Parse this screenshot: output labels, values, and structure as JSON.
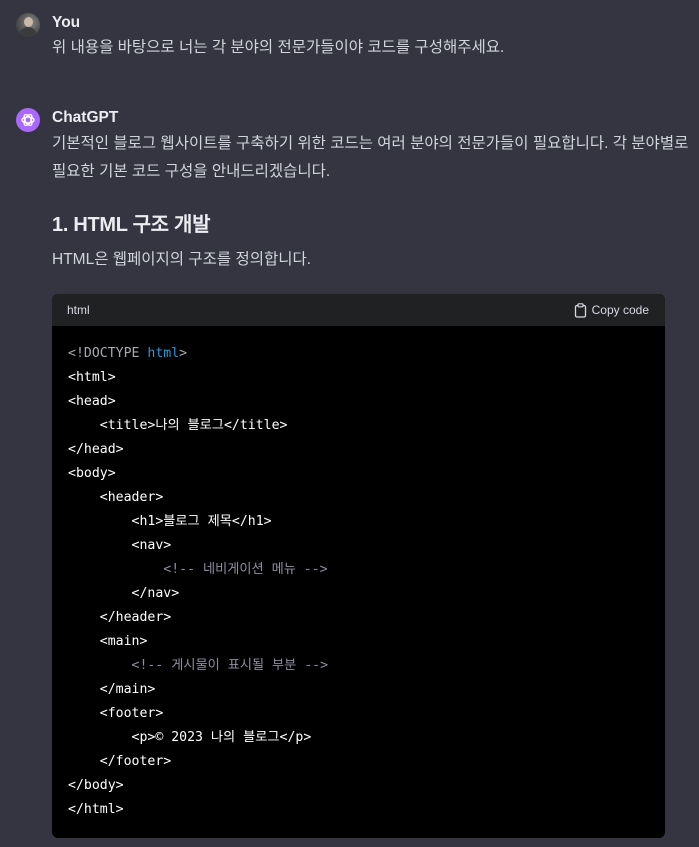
{
  "user_message": {
    "author": "You",
    "text": "위 내용을 바탕으로 너는 각 분야의 전문가들이야 코드를 구성해주세요."
  },
  "assistant_message": {
    "author": "ChatGPT",
    "intro_line1": "기본적인 블로그 웹사이트를 구축하기 위한 코드는 여러 분야의 전문가들이 필요합니다. 각 분야별로",
    "intro_line2": "필요한 기본 코드 구성을 안내드리겠습니다.",
    "section_heading": "1. HTML 구조 개발",
    "section_text": "HTML은 웹페이지의 구조를 정의합니다.",
    "code_block": {
      "language": "html",
      "copy_label": "Copy code",
      "lines": [
        {
          "indent": "",
          "parts": [
            {
              "t": "<!DOCTYPE ",
              "c": "doctype"
            },
            {
              "t": "html",
              "c": "kw"
            },
            {
              "t": ">",
              "c": "doctype"
            }
          ]
        },
        {
          "indent": "",
          "parts": [
            {
              "t": "<html>",
              "c": "tag"
            }
          ]
        },
        {
          "indent": "",
          "parts": [
            {
              "t": "<head>",
              "c": "tag"
            }
          ]
        },
        {
          "indent": "    ",
          "parts": [
            {
              "t": "<title>나의 블로그</title>",
              "c": "tag"
            }
          ]
        },
        {
          "indent": "",
          "parts": [
            {
              "t": "</head>",
              "c": "tag"
            }
          ]
        },
        {
          "indent": "",
          "parts": [
            {
              "t": "<body>",
              "c": "tag"
            }
          ]
        },
        {
          "indent": "    ",
          "parts": [
            {
              "t": "<header>",
              "c": "tag"
            }
          ]
        },
        {
          "indent": "        ",
          "parts": [
            {
              "t": "<h1>블로그 제목</h1>",
              "c": "tag"
            }
          ]
        },
        {
          "indent": "        ",
          "parts": [
            {
              "t": "<nav>",
              "c": "tag"
            }
          ]
        },
        {
          "indent": "            ",
          "parts": [
            {
              "t": "<!-- 네비게이션 메뉴 -->",
              "c": "comment"
            }
          ]
        },
        {
          "indent": "        ",
          "parts": [
            {
              "t": "</nav>",
              "c": "tag"
            }
          ]
        },
        {
          "indent": "    ",
          "parts": [
            {
              "t": "</header>",
              "c": "tag"
            }
          ]
        },
        {
          "indent": "    ",
          "parts": [
            {
              "t": "<main>",
              "c": "tag"
            }
          ]
        },
        {
          "indent": "        ",
          "parts": [
            {
              "t": "<!-- 게시물이 표시될 부분 -->",
              "c": "comment"
            }
          ]
        },
        {
          "indent": "    ",
          "parts": [
            {
              "t": "</main>",
              "c": "tag"
            }
          ]
        },
        {
          "indent": "    ",
          "parts": [
            {
              "t": "<footer>",
              "c": "tag"
            }
          ]
        },
        {
          "indent": "        ",
          "parts": [
            {
              "t": "<p>© 2023 나의 블로그</p>",
              "c": "tag"
            }
          ]
        },
        {
          "indent": "    ",
          "parts": [
            {
              "t": "</footer>",
              "c": "tag"
            }
          ]
        },
        {
          "indent": "",
          "parts": [
            {
              "t": "</body>",
              "c": "tag"
            }
          ]
        },
        {
          "indent": "",
          "parts": [
            {
              "t": "</html>",
              "c": "tag"
            }
          ]
        }
      ]
    }
  },
  "icons": {
    "user_avatar": "user-photo-avatar",
    "assistant_avatar": "openai-logo-icon",
    "copy": "clipboard-icon"
  },
  "colors": {
    "background": "#343541",
    "assistant_avatar_bg": "#ab68ff",
    "code_bg": "#000000",
    "code_header_bg": "#202123",
    "keyword": "#2e95d3",
    "comment": "#8e8ea0"
  }
}
